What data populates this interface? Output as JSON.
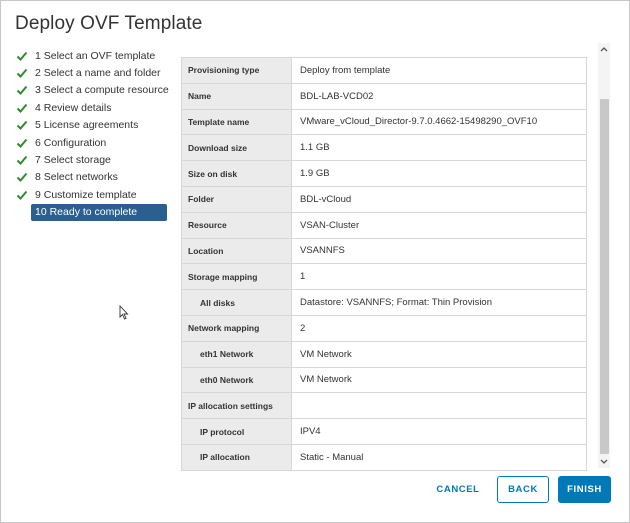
{
  "dialog": {
    "title": "Deploy OVF Template"
  },
  "steps": [
    {
      "label": "1 Select an OVF template",
      "done": true
    },
    {
      "label": "2 Select a name and folder",
      "done": true
    },
    {
      "label": "3 Select a compute resource",
      "done": true
    },
    {
      "label": "4 Review details",
      "done": true
    },
    {
      "label": "5 License agreements",
      "done": true
    },
    {
      "label": "6 Configuration",
      "done": true
    },
    {
      "label": "7 Select storage",
      "done": true
    },
    {
      "label": "8 Select networks",
      "done": true
    },
    {
      "label": "9 Customize template",
      "done": true
    },
    {
      "label": "10 Ready to complete",
      "done": false,
      "active": true
    }
  ],
  "review": {
    "rows": [
      {
        "key": "Provisioning type",
        "value": "Deploy from template",
        "sub": false
      },
      {
        "key": "Name",
        "value": "BDL-LAB-VCD02",
        "sub": false
      },
      {
        "key": "Template name",
        "value": "VMware_vCloud_Director-9.7.0.4662-15498290_OVF10",
        "sub": false
      },
      {
        "key": "Download size",
        "value": "1.1 GB",
        "sub": false
      },
      {
        "key": "Size on disk",
        "value": "1.9 GB",
        "sub": false
      },
      {
        "key": "Folder",
        "value": "BDL-vCloud",
        "sub": false
      },
      {
        "key": "Resource",
        "value": "VSAN-Cluster",
        "sub": false
      },
      {
        "key": "Location",
        "value": "VSANNFS",
        "sub": false
      },
      {
        "key": "Storage mapping",
        "value": "1",
        "sub": false
      },
      {
        "key": "All disks",
        "value": "Datastore: VSANNFS; Format: Thin Provision",
        "sub": true
      },
      {
        "key": "Network mapping",
        "value": "2",
        "sub": false
      },
      {
        "key": "eth1 Network",
        "value": "VM Network",
        "sub": true
      },
      {
        "key": "eth0 Network",
        "value": "VM Network",
        "sub": true
      },
      {
        "key": "IP allocation settings",
        "value": "",
        "sub": false
      },
      {
        "key": "IP protocol",
        "value": "IPV4",
        "sub": true
      },
      {
        "key": "IP allocation",
        "value": "Static - Manual",
        "sub": true
      }
    ]
  },
  "buttons": {
    "cancel": "CANCEL",
    "back": "BACK",
    "finish": "FINISH"
  },
  "colors": {
    "accent": "#0079b8",
    "active_step": "#2a5f8f",
    "check": "#2e8b2e"
  }
}
